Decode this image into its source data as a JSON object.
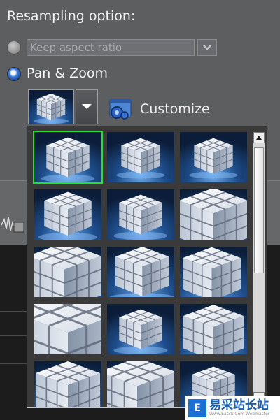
{
  "resampling": {
    "heading": "Resampling option:",
    "keep_aspect": {
      "label": "Keep aspect ratio",
      "selected": false,
      "disabled": true
    },
    "pan_zoom": {
      "label": "Pan & Zoom",
      "selected": true
    }
  },
  "toolbar": {
    "customize_label": "Customize",
    "dropdown_icon": "chevron-down-icon",
    "customize_icon": "gear-window-icon"
  },
  "gallery": {
    "selected_index": 0,
    "items": [
      {
        "name": "cube-preset-1"
      },
      {
        "name": "cube-preset-2"
      },
      {
        "name": "cube-preset-3"
      },
      {
        "name": "cube-preset-4"
      },
      {
        "name": "cube-preset-5"
      },
      {
        "name": "cube-preset-6"
      },
      {
        "name": "cube-preset-7"
      },
      {
        "name": "cube-preset-8"
      },
      {
        "name": "cube-preset-9"
      },
      {
        "name": "cube-preset-10"
      },
      {
        "name": "cube-preset-11"
      },
      {
        "name": "cube-preset-12"
      },
      {
        "name": "cube-preset-13"
      },
      {
        "name": "cube-preset-14"
      },
      {
        "name": "cube-preset-15"
      }
    ]
  },
  "watermark": {
    "text": "易采站长站",
    "subtext": "Www.Easck.Com  Webmaster"
  },
  "colors": {
    "selection": "#27e02c",
    "panel": "#5d5e60",
    "text": "#f2f2f2"
  }
}
